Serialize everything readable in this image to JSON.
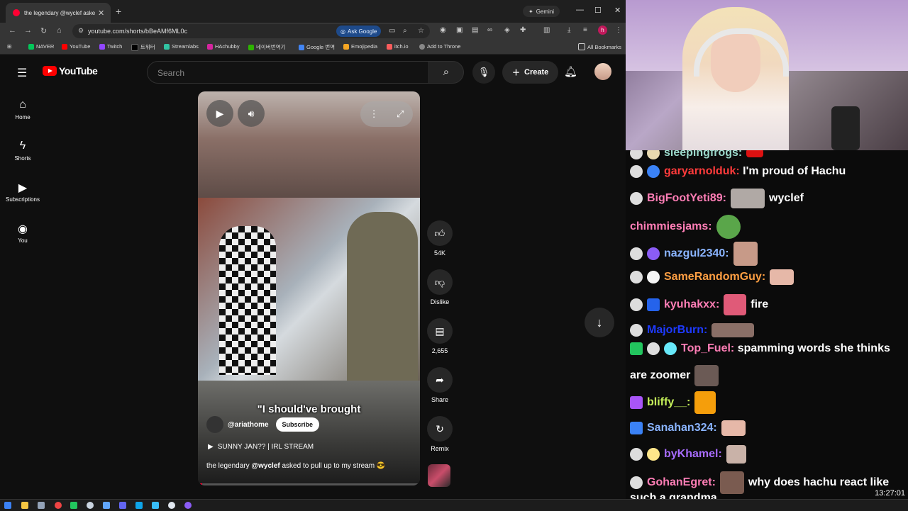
{
  "browser": {
    "tab_title": "the legendary @wyclef asked to",
    "tab_close": "✕",
    "new_tab": "+",
    "gemini_label": "Gemini",
    "url": "youtube.com/shorts/bBeAMf6ML0c",
    "ask_google": "Ask Google",
    "profile_letter": "h",
    "bookmarks": [
      "NAVER",
      "YouTube",
      "Twitch",
      "트위터",
      "Streamlabs",
      "HAchubby",
      "네이버번역기",
      "Google 번역",
      "Emojipedia",
      "itch.io",
      "Add to Throne"
    ],
    "all_bookmarks": "All Bookmarks"
  },
  "youtube": {
    "logo_text": "YouTube",
    "search_placeholder": "Search",
    "create_label": "Create",
    "sidenav": [
      {
        "label": "Home",
        "icon": "home-icon"
      },
      {
        "label": "Shorts",
        "icon": "shorts-icon"
      },
      {
        "label": "Subscriptions",
        "icon": "subscriptions-icon"
      },
      {
        "label": "You",
        "icon": "you-icon"
      }
    ],
    "short": {
      "caption": "\"I should've brought",
      "channel": "@ariathome",
      "subscribe": "Subscribe",
      "music": "SUNNY JAN?? | IRL STREAM",
      "desc_prefix": "the legendary ",
      "desc_mention": "@wyclef",
      "desc_suffix": " asked to pull up to my stream 😎",
      "progress_fraction": 0.02
    },
    "actions": {
      "like_count": "54K",
      "dislike_label": "Dislike",
      "comment_count": "2,655",
      "share_label": "Share",
      "remix_label": "Remix"
    }
  },
  "chat": {
    "messages": [
      {
        "user": "sleepingfrogs:",
        "color": "#9ad7c9",
        "text": ""
      },
      {
        "user": "garyarnolduk:",
        "color": "#ff3b3b",
        "text": "I'm proud of Hachu"
      },
      {
        "user": "BigFootYeti89:",
        "color": "#ff7eb6",
        "text": "wyclef"
      },
      {
        "user": "chimmiesjams:",
        "color": "#ff7eb6",
        "text": ""
      },
      {
        "user": "nazgul2340:",
        "color": "#8ab4ff",
        "text": ""
      },
      {
        "user": "SameRandomGuy:",
        "color": "#ff9f43",
        "text": ""
      },
      {
        "user": "kyuhakxx:",
        "color": "#ff7eb6",
        "text": "fire"
      },
      {
        "user": "MajorBurn:",
        "color": "#1e3aff",
        "text": ""
      },
      {
        "user": "Top_Fuel:",
        "color": "#ff7eb6",
        "text": "spamming words she thinks"
      },
      {
        "user": "",
        "color": "#ffffff",
        "text": "are zoomer"
      },
      {
        "user": "bliffy__:",
        "color": "#c6f25a",
        "text": ""
      },
      {
        "user": "Sanahan324:",
        "color": "#8ab4ff",
        "text": ""
      },
      {
        "user": "byKhamel:",
        "color": "#a86cff",
        "text": ""
      },
      {
        "user": "GohanEgret:",
        "color": "#ff7eb6",
        "text": "why does hachu react like"
      },
      {
        "user": "",
        "color": "#ffffff",
        "text": "such a grandma"
      }
    ],
    "clock": "13:27:01"
  }
}
